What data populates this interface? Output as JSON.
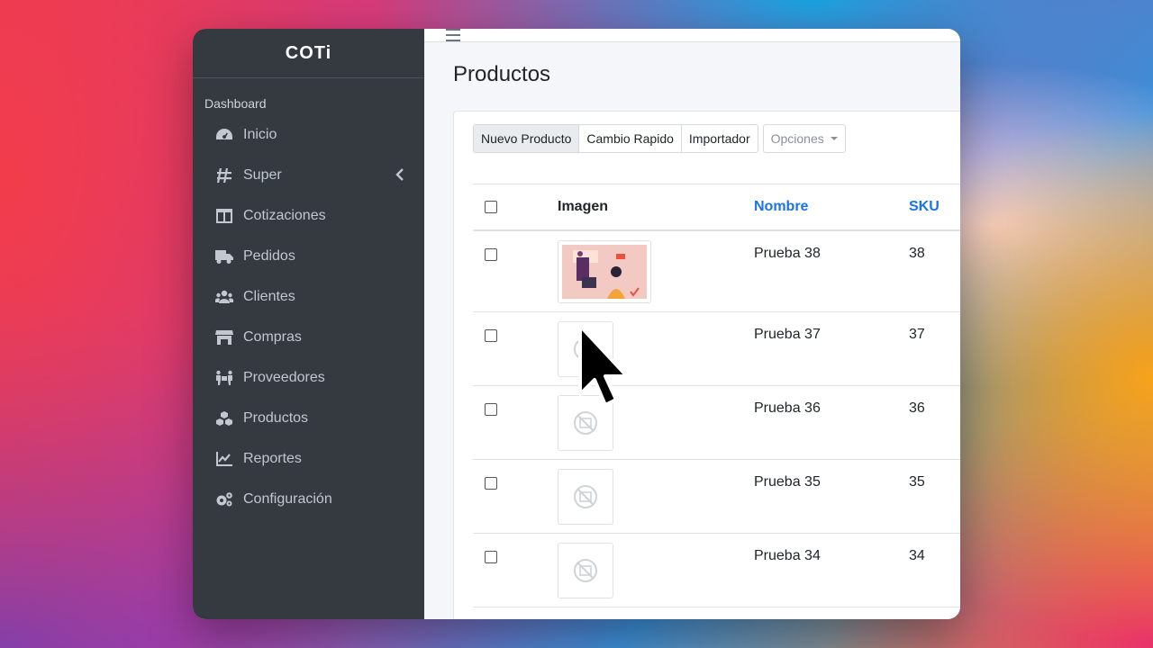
{
  "app": {
    "brand": "COTi"
  },
  "sidebar": {
    "header": "Dashboard",
    "items": [
      {
        "label": "Inicio",
        "icon": "tachometer-icon"
      },
      {
        "label": "Super",
        "icon": "hashtag-icon",
        "has_submenu": true
      },
      {
        "label": "Cotizaciones",
        "icon": "columns-icon"
      },
      {
        "label": "Pedidos",
        "icon": "truck-icon"
      },
      {
        "label": "Clientes",
        "icon": "users-icon"
      },
      {
        "label": "Compras",
        "icon": "store-icon"
      },
      {
        "label": "Proveedores",
        "icon": "people-carry-icon"
      },
      {
        "label": "Productos",
        "icon": "cubes-icon"
      },
      {
        "label": "Reportes",
        "icon": "chart-line-icon"
      },
      {
        "label": "Configuración",
        "icon": "cogs-icon"
      }
    ]
  },
  "main": {
    "title": "Productos",
    "toolbar": {
      "new_product": "Nuevo Producto",
      "quick_change": "Cambio Rapido",
      "importer": "Importador",
      "options": "Opciones"
    },
    "table": {
      "columns": [
        "Imagen",
        "Nombre",
        "SKU"
      ],
      "rows": [
        {
          "name": "Prueba 38",
          "sku": "38",
          "image": "product-photo"
        },
        {
          "name": "Prueba 37",
          "sku": "37",
          "image": "no-image-placeholder"
        },
        {
          "name": "Prueba 36",
          "sku": "36",
          "image": "no-image-placeholder"
        },
        {
          "name": "Prueba 35",
          "sku": "35",
          "image": "no-image-placeholder"
        },
        {
          "name": "Prueba 34",
          "sku": "34",
          "image": "no-image-placeholder"
        }
      ]
    }
  },
  "colors": {
    "sidebar_bg": "#343a40",
    "sortable_header": "#1a73e8",
    "content_bg": "#f4f6f9"
  }
}
